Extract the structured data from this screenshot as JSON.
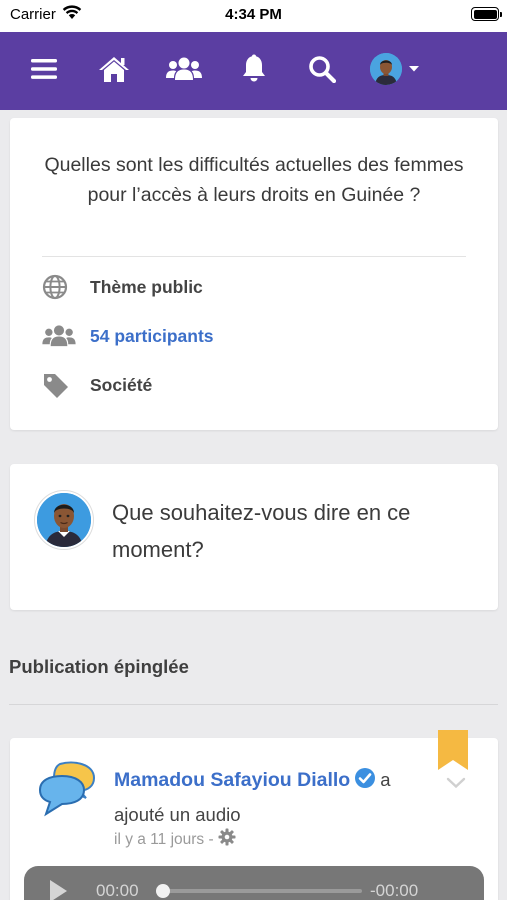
{
  "status_bar": {
    "carrier": "Carrier",
    "time": "4:34 PM"
  },
  "navbar": {
    "items": [
      {
        "icon": "menu-icon"
      },
      {
        "icon": "home-icon"
      },
      {
        "icon": "users-icon"
      },
      {
        "icon": "bell-icon"
      },
      {
        "icon": "search-icon"
      }
    ],
    "accent": "#5b3ea2"
  },
  "theme": {
    "title": "Quelles sont les difficultés actuelles des femmes pour l’accès à leurs droits en Guinée ?",
    "visibility": "Thème public",
    "participants": "54 participants",
    "category": "Société"
  },
  "composer": {
    "placeholder": "Que souhaitez-vous dire en ce moment?"
  },
  "pinned": {
    "section_title": "Publication épinglée",
    "post": {
      "author": "Mamadou Safayiou Diallo",
      "action": "a ajouté un audio",
      "time": "il y a 11 jours -",
      "audio": {
        "current": "00:00",
        "remaining": "-00:00",
        "progress": 0
      }
    }
  },
  "colors": {
    "link": "#3c6fc9",
    "bookmark": "#f5b942",
    "verified": "#3b8fe0"
  }
}
